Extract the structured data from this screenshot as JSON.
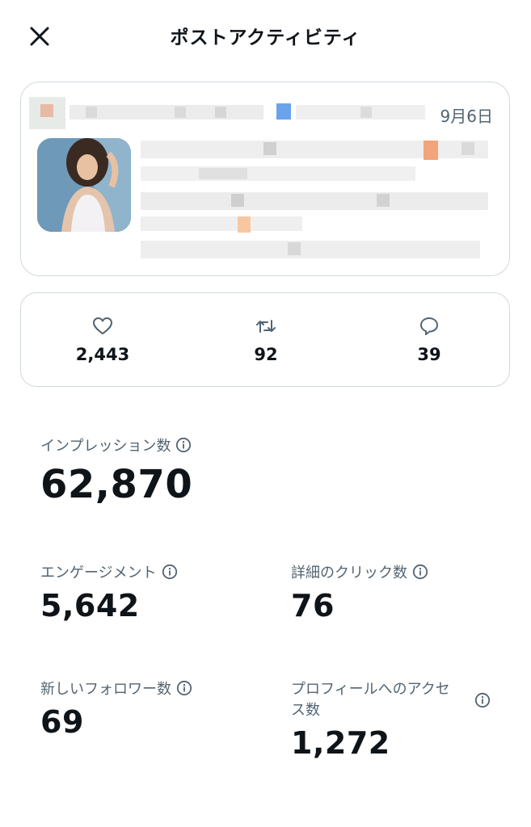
{
  "header": {
    "title": "ポストアクティビティ",
    "close_icon": "close-icon"
  },
  "post": {
    "date": "9月6日",
    "thumbnail": "post-image"
  },
  "stats": [
    {
      "icon": "heart-icon",
      "value": "2,443"
    },
    {
      "icon": "repost-icon",
      "value": "92"
    },
    {
      "icon": "reply-icon",
      "value": "39"
    }
  ],
  "metrics": {
    "impressions": {
      "label": "インプレッション数",
      "value": "62,870"
    },
    "engagements": {
      "label": "エンゲージメント",
      "value": "5,642"
    },
    "detail_clicks": {
      "label": "詳細のクリック数",
      "value": "76"
    },
    "new_followers": {
      "label": "新しいフォロワー数",
      "value": "69"
    },
    "profile_visits": {
      "label_line1": "プロフィールへのアクセ",
      "label_line2": "ス数",
      "value": "1,272"
    }
  },
  "colors": {
    "text": "#0f1419",
    "secondary": "#536471",
    "border": "#cfd9de"
  }
}
